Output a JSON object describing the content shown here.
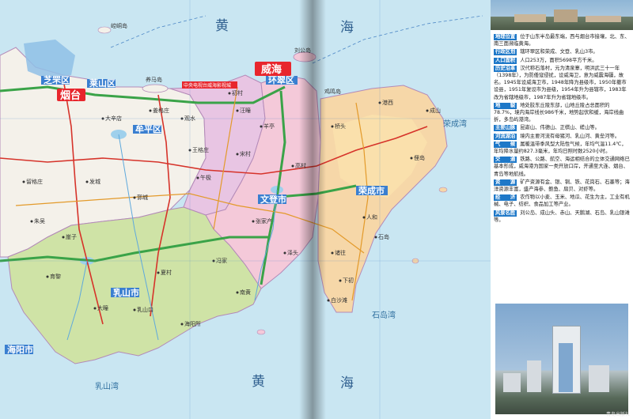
{
  "sea_labels": {
    "huang_top": "黄",
    "hai_top": "海",
    "huang_bottom": "黄",
    "hai_bottom": "海",
    "rongcheng_bay": "荣成湾",
    "shidao_bay": "石岛湾",
    "rushan_bay": "乳山湾"
  },
  "cities": {
    "yantai": "烟台",
    "weihai": "威海",
    "huancui": "环翠区",
    "laishan": "莱山区",
    "zhifu": "芝罘区",
    "muping": "牟平区",
    "wendeng": "文登市",
    "rongcheng": "荣成市",
    "rushan": "乳山市",
    "haiyang": "海阳市"
  },
  "towns": {
    "t1": "乳山口",
    "t2": "大疃",
    "t3": "育黎",
    "t4": "夏村",
    "t5": "海阳所",
    "t6": "崖子",
    "t7": "冯家",
    "t8": "诸往",
    "t9": "南黄",
    "t10": "下初",
    "t11": "白沙滩",
    "t12": "石岛",
    "t13": "人和",
    "t14": "俚岛",
    "t15": "成山",
    "t16": "港西",
    "t17": "泽头",
    "t18": "张家产",
    "t19": "高村",
    "t20": "宋村",
    "t21": "桥头",
    "t22": "羊亭",
    "t23": "汪疃",
    "t24": "初村",
    "t25": "王格庄",
    "t26": "观水",
    "t27": "午极",
    "t28": "发城",
    "t29": "留格庄",
    "t30": "郭城",
    "t31": "朱吴",
    "t32": "大辛店",
    "t33": "姜格庄",
    "t34": "养马岛",
    "t35": "崆峒岛",
    "t36": "刘公岛",
    "t37": "鸡鸣岛"
  },
  "map_notes": {
    "park_label": "中央电视台威海影视城"
  },
  "info_panel": {
    "rows": [
      {
        "tag": "地理位置",
        "text": "位于山东半岛最东端，西与烟台市接壤，北、东、南三面濒临黄海。"
      },
      {
        "tag": "行政区划",
        "text": "辖环翠区和荣成、文登、乳山3市。"
      },
      {
        "tag": "人口面积",
        "text": "人口253万，面积5698平方千米。"
      },
      {
        "tag": "历史沿革",
        "text": "汉代称石落村，元为清泉寨，明洪武三十一年（1398年），为防倭寇侵扰，设威海卫，意为威震海疆，故名。1945年设威海卫市，1948年降为县级市，1950年撤市设县，1951年复设市为县级，1954年升为县辖市，1983年改为省辖地级市，1987年升为省辖地级市。"
      },
      {
        "tag": "地　　貌",
        "text": "地处胶东丘陵东部，山地丘陵占总面积的78.7%，境内海岸线长986千米，地势起伏和缓，海岸线曲折，多岛屿港湾。"
      },
      {
        "tag": "主要山脉",
        "text": "昆嵛山、伟德山、正棋山、槎山等。"
      },
      {
        "tag": "河流湖泊",
        "text": "境内主要河流有母猪河、乳山河、黄垒河等。"
      },
      {
        "tag": "气　　候",
        "text": "属暖温带季风型大陆性气候，年均气温11.4℃，年均降水量约827.3毫米，年均日照时数2520小时。"
      },
      {
        "tag": "交　　通",
        "text": "铁路、公路、航空、海运相结合的立体交通网络已基本形成，威海港为国家一类开放口岸，开通至大连、烟台、青岛等地航线。"
      },
      {
        "tag": "资　　源",
        "text": "矿产资源有金、银、铜、铁、花岗石、石墨等；海洋资源丰富，盛产海参、鲍鱼、扇贝、对虾等。"
      },
      {
        "tag": "经　　济",
        "text": "农作物以小麦、玉米、地瓜、花生为主，工业有机械、电子、纺织、食品加工等产业。"
      },
      {
        "tag": "风景名胜",
        "text": "刘公岛、成山头、赤山、天鹅湖、石岛、乳山银滩等。"
      }
    ],
    "credit": "青岛出版社"
  }
}
